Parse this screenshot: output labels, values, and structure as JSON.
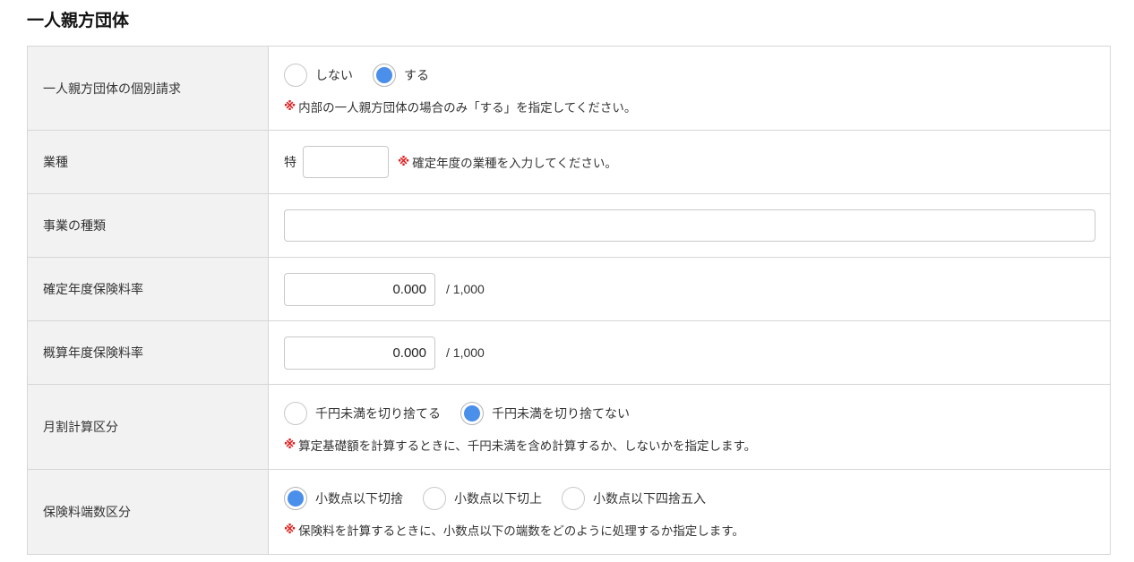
{
  "section": {
    "title": "一人親方団体"
  },
  "note_mark": "※",
  "rows": {
    "individual_billing": {
      "label": "一人親方団体の個別請求",
      "options": [
        "しない",
        "する"
      ],
      "selected": "する",
      "note": "内部の一人親方団体の場合のみ「する」を指定してください。"
    },
    "industry": {
      "label": "業種",
      "prefix": "特",
      "value": "",
      "note": "確定年度の業種を入力してください。"
    },
    "business_type": {
      "label": "事業の種類",
      "value": ""
    },
    "confirmed_rate": {
      "label": "確定年度保険料率",
      "value": "0.000",
      "unit": "/ 1,000"
    },
    "estimated_rate": {
      "label": "概算年度保険料率",
      "value": "0.000",
      "unit": "/ 1,000"
    },
    "monthly_calc": {
      "label": "月割計算区分",
      "options": [
        "千円未満を切り捨てる",
        "千円未満を切り捨てない"
      ],
      "selected": "千円未満を切り捨てない",
      "note": "算定基礎額を計算するときに、千円未満を含め計算するか、しないかを指定します。"
    },
    "fraction_rounding": {
      "label": "保険料端数区分",
      "options": [
        "小数点以下切捨",
        "小数点以下切上",
        "小数点以下四捨五入"
      ],
      "selected": "小数点以下切捨",
      "note": "保険料を計算するときに、小数点以下の端数をどのように処理するか指定します。"
    }
  },
  "colors": {
    "accent": "#4a8fea",
    "note_mark": "#e02020",
    "label_bg": "#f2f2f2",
    "border": "#d6d6d6"
  }
}
